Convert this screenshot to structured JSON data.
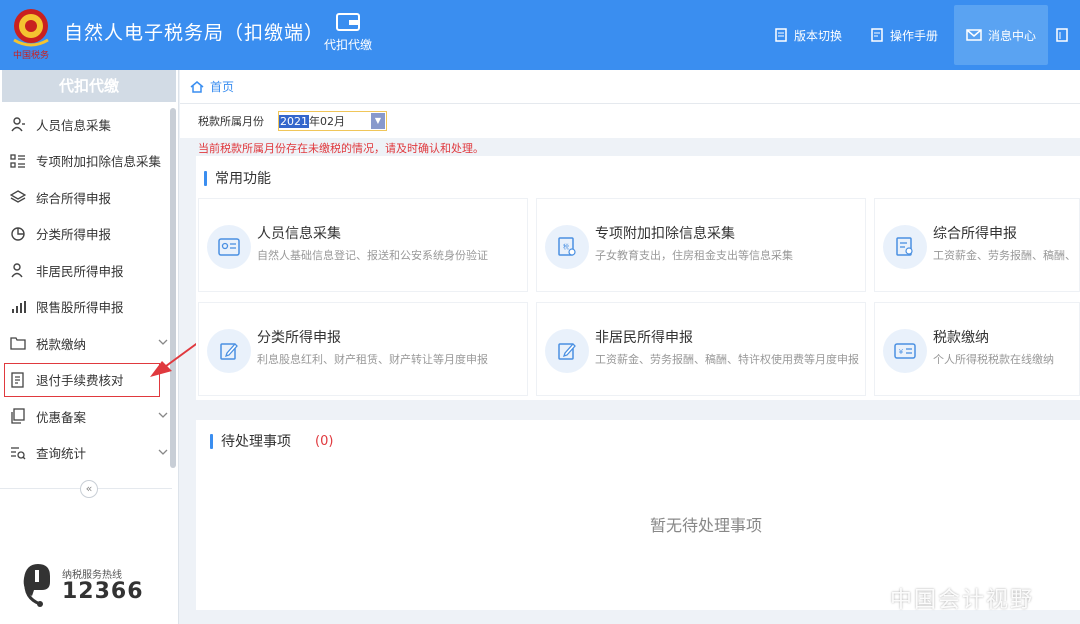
{
  "header": {
    "app_title": "自然人电子税务局（扣缴端）",
    "module_label": "代扣代缴",
    "links": [
      {
        "label": "版本切换",
        "icon": "file-icon"
      },
      {
        "label": "操作手册",
        "icon": "manual-icon"
      },
      {
        "label": "消息中心",
        "icon": "mail-icon"
      }
    ],
    "emblem_text": "中国税务"
  },
  "sidebar": {
    "title": "代扣代缴",
    "items": [
      {
        "label": "人员信息采集",
        "icon": "person-icon"
      },
      {
        "label": "专项附加扣除信息采集",
        "icon": "grid-list-icon"
      },
      {
        "label": "综合所得申报",
        "icon": "layers-icon"
      },
      {
        "label": "分类所得申报",
        "icon": "pie-icon"
      },
      {
        "label": "非居民所得申报",
        "icon": "user-icon"
      },
      {
        "label": "限售股所得申报",
        "icon": "bar-chart-icon"
      },
      {
        "label": "税款缴纳",
        "icon": "folder-icon"
      },
      {
        "label": "退付手续费核对",
        "icon": "document-icon"
      },
      {
        "label": "优惠备案",
        "icon": "copy-icon"
      },
      {
        "label": "查询统计",
        "icon": "search-list-icon"
      }
    ],
    "collapse_symbol": "«",
    "hotline_label": "纳税服务热线",
    "hotline_number": "12366"
  },
  "breadcrumb": {
    "home_label": "首页"
  },
  "period": {
    "label": "税款所属月份",
    "year": "2021",
    "rest": "年02月"
  },
  "warning": "当前税款所属月份存在未缴税的情况，请及时确认和处理。",
  "common": {
    "title": "常用功能",
    "cards": [
      {
        "title": "人员信息采集",
        "desc": "自然人基础信息登记、报送和公安系统身份验证",
        "icon": "id-card-icon"
      },
      {
        "title": "专项附加扣除信息采集",
        "desc": "子女教育支出，住房租金支出等信息采集",
        "icon": "tax-doc-icon"
      },
      {
        "title": "综合所得申报",
        "desc": "工资薪金、劳务报酬、稿酬、",
        "icon": "report-icon"
      },
      {
        "title": "分类所得申报",
        "desc": "利息股息红利、财产租赁、财产转让等月度申报",
        "icon": "edit-icon"
      },
      {
        "title": "非居民所得申报",
        "desc": "工资薪金、劳务报酬、稿酬、特许权使用费等月度申报",
        "icon": "edit-icon"
      },
      {
        "title": "税款缴纳",
        "desc": "个人所得税税款在线缴纳",
        "icon": "payment-icon"
      }
    ]
  },
  "pending": {
    "title": "待处理事项",
    "count": "(0)",
    "empty_text": "暂无待处理事项"
  },
  "watermark": "中国会计视野",
  "colors": {
    "brand": "#3a8ef0",
    "alert": "#e0393e"
  }
}
